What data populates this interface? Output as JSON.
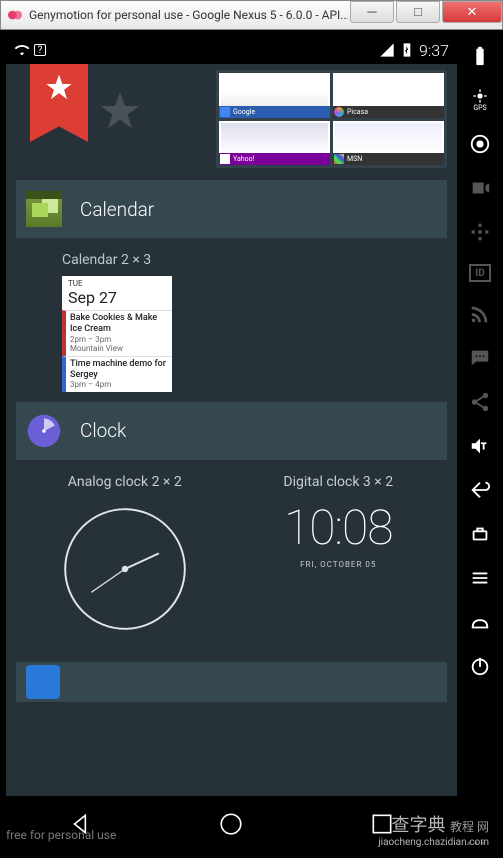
{
  "window": {
    "title": "Genymotion for personal use - Google Nexus 5 - 6.0.0 - API..."
  },
  "status_bar": {
    "time": "9:37"
  },
  "thumbnails": [
    {
      "label": "Google"
    },
    {
      "label": "Picasa"
    },
    {
      "label": "Yahoo!"
    },
    {
      "label": "MSN"
    }
  ],
  "sections": {
    "calendar": {
      "title": "Calendar",
      "widget_label": "Calendar  2 × 3",
      "date": {
        "dow": "TUE",
        "day": "Sep 27"
      },
      "events": [
        {
          "title": "Bake Cookies & Make Ice Cream",
          "time": "2pm – 3pm",
          "loc": "Mountain View"
        },
        {
          "title": "Time machine demo for Sergey",
          "time": "3pm – 4pm",
          "loc": ""
        }
      ]
    },
    "clock": {
      "title": "Clock",
      "analog_label": "Analog clock  2 × 2",
      "digital_label": "Digital clock  3 × 2",
      "digital_time": "10:08",
      "digital_date": "FRI, OCTOBER 05"
    }
  },
  "watermark": {
    "free": "free for personal use",
    "brand": "查字典",
    "brand_sub": "教程 网",
    "url": "jiaocheng.chazidian.com"
  },
  "side_icons": [
    "battery",
    "gps",
    "camera",
    "record",
    "dpad",
    "id",
    "rss",
    "sms",
    "share",
    "volume",
    "back",
    "rotate",
    "menu",
    "power"
  ]
}
